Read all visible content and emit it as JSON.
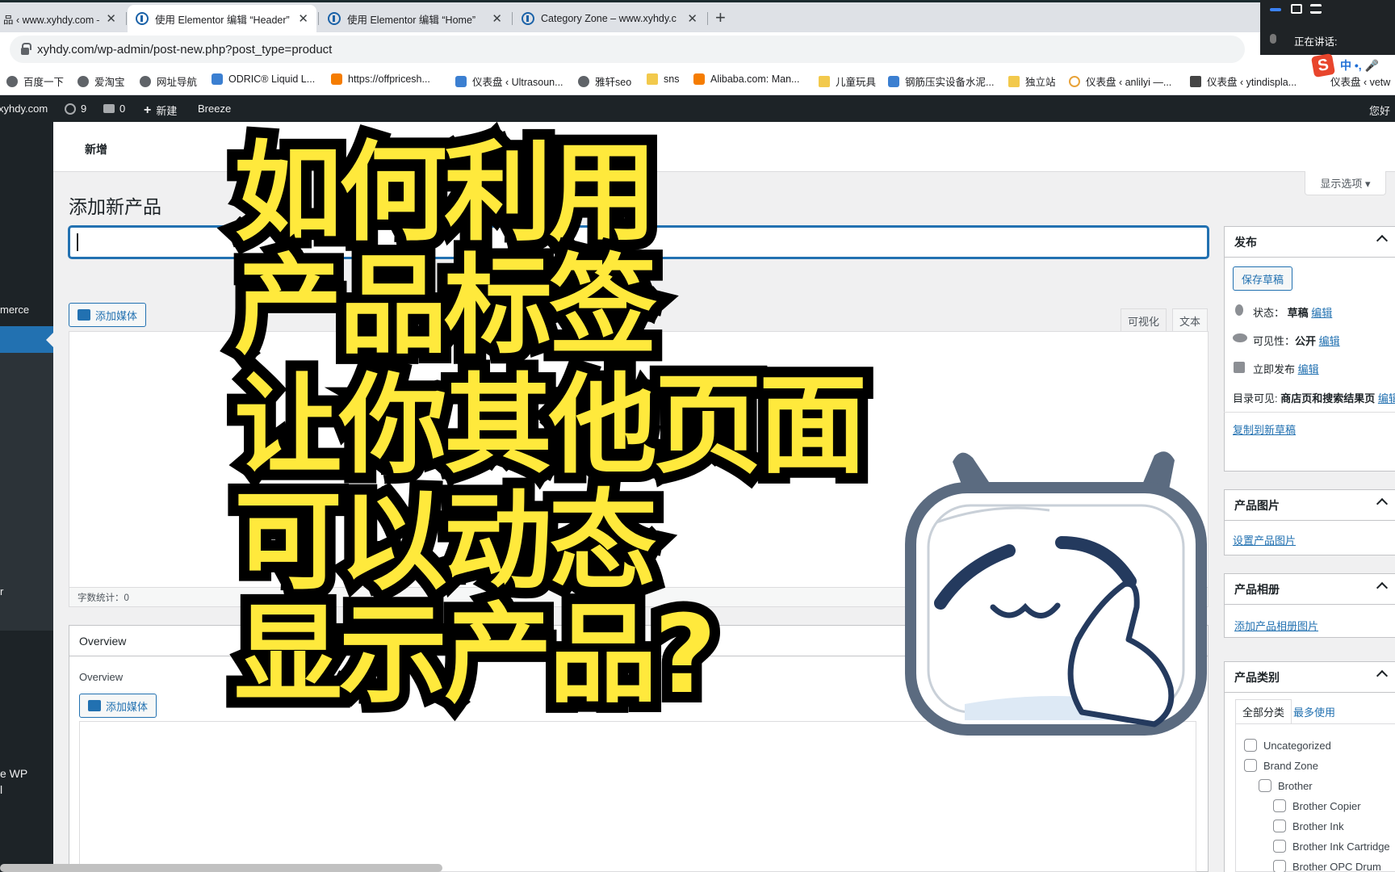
{
  "browser": {
    "tabs": [
      {
        "label": "品 ‹ www.xyhdy.com –"
      },
      {
        "label": "使用 Elementor 编辑 “Header”"
      },
      {
        "label": "使用 Elementor 编辑 “Home”"
      },
      {
        "label": "Category Zone – www.xyhdy.c"
      }
    ],
    "close_glyph": "✕",
    "new_tab_glyph": "+",
    "url": "xyhdy.com/wp-admin/post-new.php?post_type=product",
    "bookmarks": [
      {
        "label": "百度一下",
        "icon": "globe-icon"
      },
      {
        "label": "爱淘宝",
        "icon": "globe-icon"
      },
      {
        "label": "网址导航",
        "icon": "globe-icon"
      },
      {
        "label": "ODRIC® Liquid L...",
        "icon": "brand-icon"
      },
      {
        "label": "https://offpricesh...",
        "icon": "site-icon"
      },
      {
        "label": "仪表盘 ‹ Ultrasoun...",
        "icon": "site-icon"
      },
      {
        "label": "雅轩seo",
        "icon": "globe-icon"
      },
      {
        "label": "sns",
        "icon": "folder-icon"
      },
      {
        "label": "Alibaba.com: Man...",
        "icon": "alibaba-icon"
      },
      {
        "label": "儿童玩具",
        "icon": "folder-icon"
      },
      {
        "label": "钢筋压实设备水泥...",
        "icon": "site-icon"
      },
      {
        "label": "独立站",
        "icon": "folder-icon"
      },
      {
        "label": "仪表盘 ‹ anlilyi —...",
        "icon": "site-icon"
      },
      {
        "label": "仪表盘 ‹ ytindispla...",
        "icon": "site-icon"
      },
      {
        "label": "仪表盘 ‹ vetw",
        "icon": "site-icon"
      }
    ]
  },
  "voice": {
    "label": "正在讲话:",
    "ime_label": "中 •, 🎤"
  },
  "adminbar": {
    "site": "xyhdy.com",
    "updates": "9",
    "comments": "0",
    "new": "新建",
    "breeze": "Breeze",
    "howdy": "您好"
  },
  "leftmenu": {
    "woo": "merce",
    "r": "r",
    "wp1": "e WP",
    "wp2": "l"
  },
  "page": {
    "subheader": "新增",
    "title": "添加新产品",
    "screen_options": "显示选项 ▾",
    "add_media": "添加媒体",
    "tab_visual": "可视化",
    "tab_text": "文本",
    "word_count": "字数统计：0",
    "overview_header": "Overview",
    "overview_label": "Overview"
  },
  "publish": {
    "header": "发布",
    "save_draft": "保存草稿",
    "status_label": "状态：",
    "status_value": "草稿",
    "visibility_label": "可见性：",
    "visibility_value": "公开",
    "publish_now": "立即发布",
    "edit": "编辑",
    "catalog_label": "目录可见:",
    "catalog_value": "商店页和搜索结果页",
    "catalog_edit": "编辑",
    "copy_draft": "复制到新草稿"
  },
  "product_image": {
    "header": "产品图片",
    "link": "设置产品图片"
  },
  "product_gallery": {
    "header": "产品相册",
    "link": "添加产品相册图片"
  },
  "product_cats": {
    "header": "产品类别",
    "tab_all": "全部分类",
    "tab_popular": "最多使用",
    "items": [
      {
        "label": "Uncategorized",
        "level": 0
      },
      {
        "label": "Brand Zone",
        "level": 0
      },
      {
        "label": "Brother",
        "level": 1
      },
      {
        "label": "Brother Copier",
        "level": 2
      },
      {
        "label": "Brother Ink",
        "level": 2
      },
      {
        "label": "Brother Ink Cartridge",
        "level": 2
      },
      {
        "label": "Brother OPC Drum",
        "level": 2
      }
    ]
  },
  "overlay": {
    "lines": [
      "如何利用",
      "产品标签",
      "让你其他页面",
      "可以动态",
      "显示产品?"
    ],
    "text_color": "#ffe93c"
  }
}
